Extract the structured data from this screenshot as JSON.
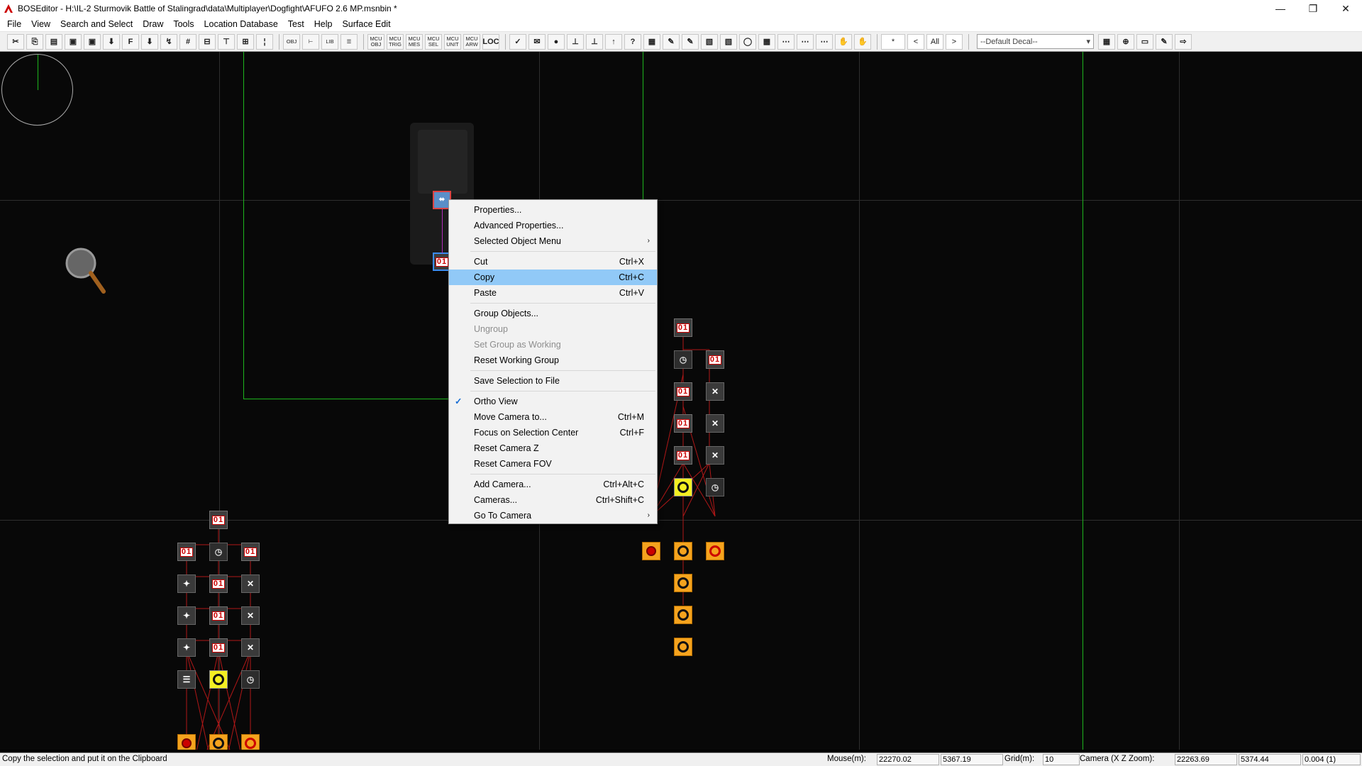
{
  "title": "BOSEditor - H:\\IL-2 Sturmovik Battle of Stalingrad\\data\\Multiplayer\\Dogfight\\AFUFO 2.6 MP.msnbin *",
  "menu": [
    "File",
    "View",
    "Search and Select",
    "Draw",
    "Tools",
    "Location Database",
    "Test",
    "Help",
    "Surface Edit"
  ],
  "toolbar": {
    "buttons_a": [
      "✂",
      "⎘",
      "▤",
      "▣",
      "▣",
      "⬇",
      "F",
      "⬇",
      "↯",
      "#",
      "⊟",
      "⊤",
      "⊞",
      "¦"
    ],
    "buttons_b": [
      "OBJ",
      "⊢",
      "LIB",
      "☰"
    ],
    "mcu": [
      "MCU OBJ",
      "MCU TRIG",
      "MCU MES",
      "MCU SEL",
      "MCU UNIT",
      "MCU ARW"
    ],
    "loc": "LOC",
    "buttons_c": [
      "✓",
      "✉",
      "●",
      "⊥",
      "⊥",
      "↑",
      "?",
      "▦",
      "✎",
      "✎",
      "▧",
      "▧",
      "◯",
      "▩",
      "⋯",
      "⋯",
      "⋯",
      "✋",
      "✋"
    ],
    "filter_text": "*",
    "filter_prev": "<",
    "filter_all": "All",
    "filter_next": ">",
    "decal": "--Default Decal--",
    "buttons_d": [
      "▦",
      "⊕",
      "▭",
      "✎",
      "⇨"
    ]
  },
  "context_menu": [
    {
      "label": "Properties...",
      "shortcut": "",
      "sub": false,
      "disabled": false,
      "highlight": false,
      "checked": false
    },
    {
      "label": "Advanced Properties...",
      "shortcut": "",
      "sub": false,
      "disabled": false,
      "highlight": false,
      "checked": false
    },
    {
      "label": "Selected Object Menu",
      "shortcut": "",
      "sub": true,
      "disabled": false,
      "highlight": false,
      "checked": false
    },
    {
      "sep": true
    },
    {
      "label": "Cut",
      "shortcut": "Ctrl+X",
      "sub": false,
      "disabled": false,
      "highlight": false,
      "checked": false
    },
    {
      "label": "Copy",
      "shortcut": "Ctrl+C",
      "sub": false,
      "disabled": false,
      "highlight": true,
      "checked": false
    },
    {
      "label": "Paste",
      "shortcut": "Ctrl+V",
      "sub": false,
      "disabled": false,
      "highlight": false,
      "checked": false
    },
    {
      "sep": true
    },
    {
      "label": "Group Objects...",
      "shortcut": "",
      "sub": false,
      "disabled": false,
      "highlight": false,
      "checked": false
    },
    {
      "label": "Ungroup",
      "shortcut": "",
      "sub": false,
      "disabled": true,
      "highlight": false,
      "checked": false
    },
    {
      "label": "Set Group as Working",
      "shortcut": "",
      "sub": false,
      "disabled": true,
      "highlight": false,
      "checked": false
    },
    {
      "label": "Reset Working Group",
      "shortcut": "",
      "sub": false,
      "disabled": false,
      "highlight": false,
      "checked": false
    },
    {
      "sep": true
    },
    {
      "label": "Save Selection to File",
      "shortcut": "",
      "sub": false,
      "disabled": false,
      "highlight": false,
      "checked": false
    },
    {
      "sep": true
    },
    {
      "label": "Ortho View",
      "shortcut": "",
      "sub": false,
      "disabled": false,
      "highlight": false,
      "checked": true
    },
    {
      "label": "Move Camera to...",
      "shortcut": "Ctrl+M",
      "sub": false,
      "disabled": false,
      "highlight": false,
      "checked": false
    },
    {
      "label": "Focus on Selection Center",
      "shortcut": "Ctrl+F",
      "sub": false,
      "disabled": false,
      "highlight": false,
      "checked": false
    },
    {
      "label": "Reset Camera Z",
      "shortcut": "",
      "sub": false,
      "disabled": false,
      "highlight": false,
      "checked": false
    },
    {
      "label": "Reset Camera FOV",
      "shortcut": "",
      "sub": false,
      "disabled": false,
      "highlight": false,
      "checked": false
    },
    {
      "sep": true
    },
    {
      "label": "Add Camera...",
      "shortcut": "Ctrl+Alt+C",
      "sub": false,
      "disabled": false,
      "highlight": false,
      "checked": false
    },
    {
      "label": "Cameras...",
      "shortcut": "Ctrl+Shift+C",
      "sub": false,
      "disabled": false,
      "highlight": false,
      "checked": false
    },
    {
      "label": "Go To Camera",
      "shortcut": "",
      "sub": true,
      "disabled": false,
      "highlight": false,
      "checked": false
    }
  ],
  "node_text": {
    "counter": "01",
    "timer": "◷",
    "deact": "✕",
    "check": "✓",
    "sub_arrow": "›"
  },
  "status": {
    "message": "Copy the selection and put it on the Clipboard",
    "mouse_label": "Mouse(m):",
    "mouse_x": "22270.02",
    "mouse_z": "5367.19",
    "grid_label": "Grid(m):",
    "grid_value": "10",
    "camera_label": "Camera (X  Z  Zoom):",
    "camera_x": "22263.69",
    "camera_z": "5374.44",
    "camera_zoom": "0.004 (1)"
  },
  "window_controls": {
    "minimize": "—",
    "restore": "❐",
    "close": "✕"
  }
}
